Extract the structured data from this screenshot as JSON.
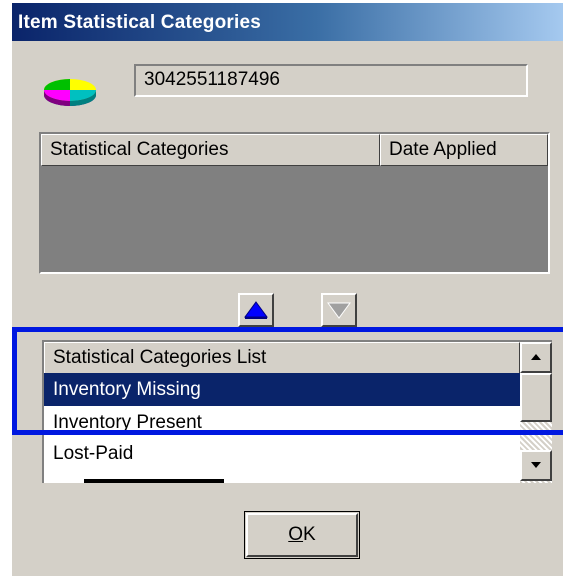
{
  "window": {
    "title": "Item Statistical Categories"
  },
  "item": {
    "barcode": "3042551187496",
    "icon": "pie-chart-icon"
  },
  "applied_table": {
    "columns": [
      "Statistical Categories",
      "Date Applied"
    ],
    "rows": []
  },
  "move_buttons": {
    "up_icon": "move-up-arrow-icon",
    "down_icon": "move-down-arrow-icon"
  },
  "category_list": {
    "header": "Statistical Categories List",
    "items": [
      {
        "label": "Inventory Missing",
        "selected": true
      },
      {
        "label": "Inventory Present",
        "selected": false
      },
      {
        "label": "Lost-Paid",
        "selected": false
      }
    ]
  },
  "ok_button": {
    "mnemonic": "O",
    "rest": "K"
  },
  "colors": {
    "title_bar_start": "#0a246a",
    "title_bar_end": "#a6caf0",
    "selection": "#0a246a",
    "highlight_frame": "#0018e0",
    "face": "#d4d0c8"
  }
}
